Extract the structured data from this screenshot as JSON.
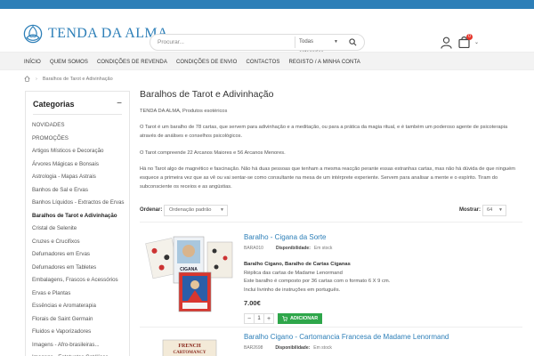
{
  "header": {
    "logo_text": "TENDA DA ALMA",
    "search_placeholder": "Procurar...",
    "category_select": "Todas categorias",
    "cart_count": "0"
  },
  "nav": {
    "items": [
      "Início",
      "Quem Somos",
      "Condições de Revenda",
      "Condições de Envio",
      "Contactos",
      "Registo / A Minha Conta"
    ]
  },
  "breadcrumb": {
    "current": "Baralhos de Tarot e Adivinhação"
  },
  "sidebar": {
    "title": "Categorias",
    "toggle": "−",
    "items": [
      "NOVIDADES",
      "PROMOÇÕES",
      "Artigos Místicos e Decoração",
      "Árvores Mágicas e Bonsais",
      "Astrologia - Mapas Astrais",
      "Banhos de Sal e Ervas",
      "Banhos Líquidos - Extractos de Ervas",
      "Baralhos de Tarot e Adivinhação",
      "Cristal de Selenite",
      "Cruzes e Crucifixos",
      "Defumadores em Ervas",
      "Defumadores em Tabletes",
      "Embalagens, Frascos e Acessórios",
      "Ervas e Plantas",
      "Essências e Aromaterapia",
      "Florais de Saint Germain",
      "Fluidos e Vaporizadores",
      "Imagens - Afro-brasileiras...",
      "Imagens - Estatuetas Católicas"
    ],
    "active_index": 7
  },
  "main": {
    "title": "Baralhos de Tarot e Adivinhação",
    "paragraphs": [
      "TENDA DA ALMA, Produtos esotéricos",
      "O Tarot é um baralho de 78 cartas, que servem para adivinhação e a meditação, ou para a prática da magia ritual, e é também um poderoso agente de psicoterapia através de análises e conselhos psicológicos.",
      "O Tarot compreende 22 Arcanos Maiores e 56 Arcanos Menores.",
      "Há no Tarot algo de magnético e fascinação. Não há duas pessoas que tenham a mesma reacção perante essas estranhas cartas, mas não há dúvida de que ninguém esquece a primeira vez que as vê ou vai sentar-se como consultante na mesa de um intérprete experiente. Servem para analisar a mente e o espírito. Tiram do subconsciente os receios e as angústias."
    ],
    "sort_label": "Ordenar:",
    "sort_value": "Ordenação padrão",
    "show_label": "Mostrar:",
    "show_value": "64"
  },
  "products": [
    {
      "name": "Baralho - Cigana da Sorte",
      "sku": "BARA010",
      "availability_label": "Disponibilidade:",
      "availability": "Em stock",
      "lines": [
        "Baralho Cigano, Baralho de Cartas Ciganas",
        "Réplica das cartas de Madame Lenormand",
        "Este baralho é composto por 36 cartas com o formato 6 X 9 cm.",
        "Inclui livrinho de instruções em português."
      ],
      "price": "7.00€",
      "qty": "1",
      "add_label": "Adicionar",
      "image_text": [
        "CIGANA",
        "DA SORTE"
      ]
    },
    {
      "name": "Baralho Cigano - Cartomancia Francesa de Madame Lenormand",
      "sku": "BAR2698",
      "availability_label": "Disponibilidade:",
      "availability": "Em stock",
      "image_text": [
        "FRENCH",
        "CARTOMANCY"
      ]
    }
  ],
  "colors": {
    "brand": "#2d7fb8",
    "add_button": "#2ea64a",
    "badge": "#e5362c"
  }
}
